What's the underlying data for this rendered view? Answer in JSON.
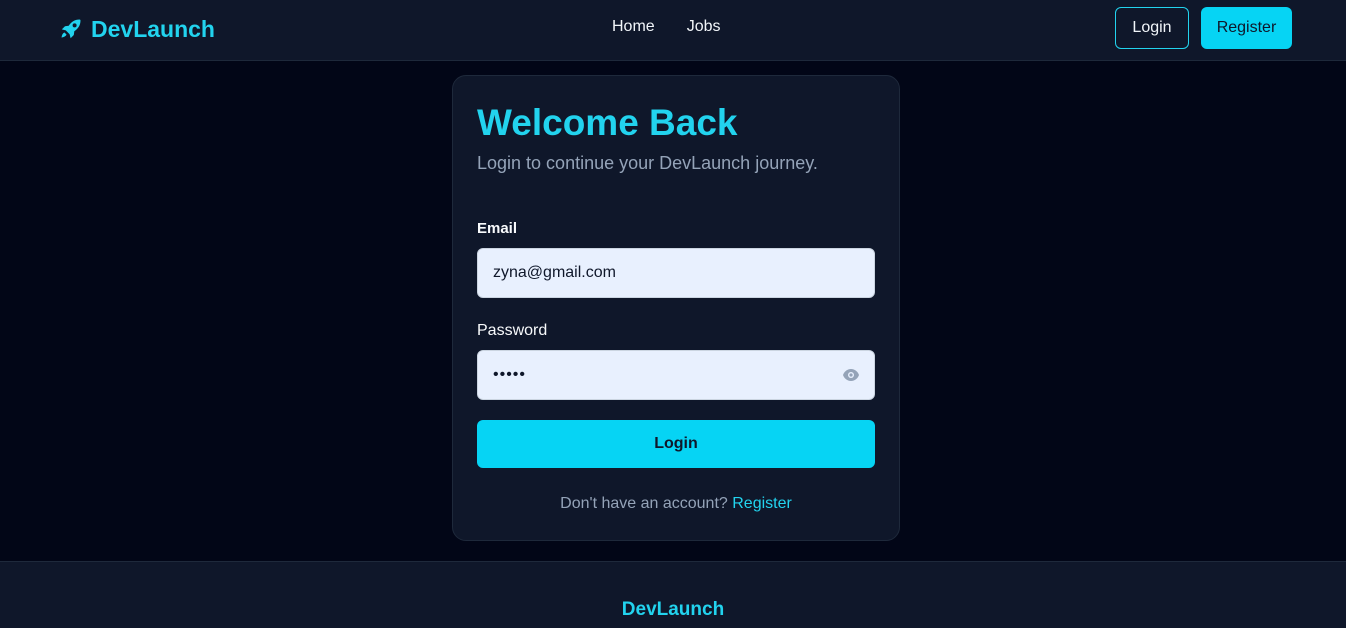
{
  "navbar": {
    "brand": "DevLaunch",
    "brand_icon": "rocket-icon",
    "links": [
      "Home",
      "Jobs"
    ],
    "login_label": "Login",
    "register_label": "Register"
  },
  "login_card": {
    "title": "Welcome Back",
    "subtitle": "Login to continue your DevLaunch journey.",
    "email_label": "Email",
    "email_value": "zyna@gmail.com",
    "password_label": "Password",
    "password_value": "•••••",
    "password_toggle_icon": "eye-icon",
    "submit_label": "Login",
    "switch_text": "Don't have an account?",
    "switch_link": "Register"
  },
  "footer": {
    "brand": "DevLaunch"
  },
  "colors": {
    "accent": "#22d3ee",
    "button": "#06d4f4",
    "background": "#020617",
    "surface": "#0f172a"
  }
}
